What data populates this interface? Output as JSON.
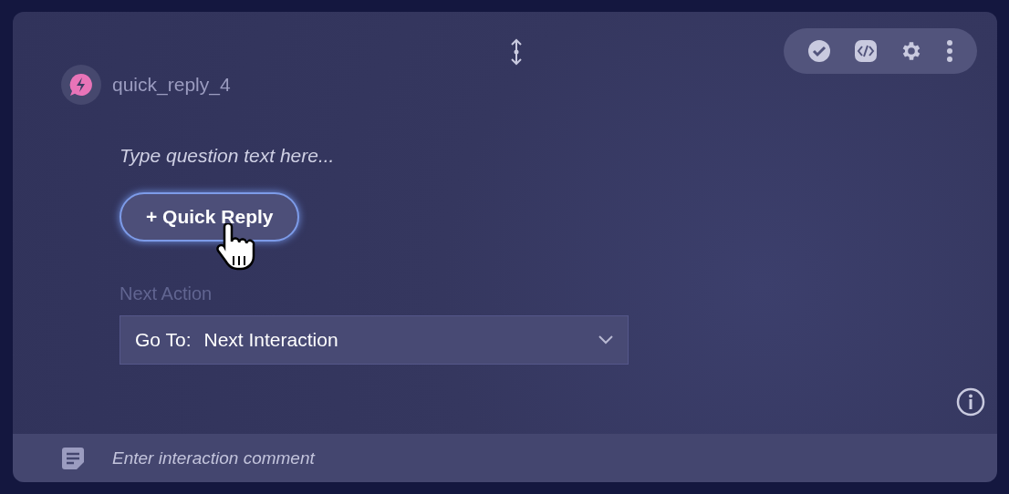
{
  "node": {
    "name": "quick_reply_4"
  },
  "question": {
    "placeholder": "Type question text here..."
  },
  "add_button": {
    "label": "+ Quick Reply"
  },
  "next_action": {
    "label": "Next Action",
    "prefix": "Go To:",
    "value": "Next Interaction"
  },
  "comment": {
    "placeholder": "Enter interaction comment"
  }
}
